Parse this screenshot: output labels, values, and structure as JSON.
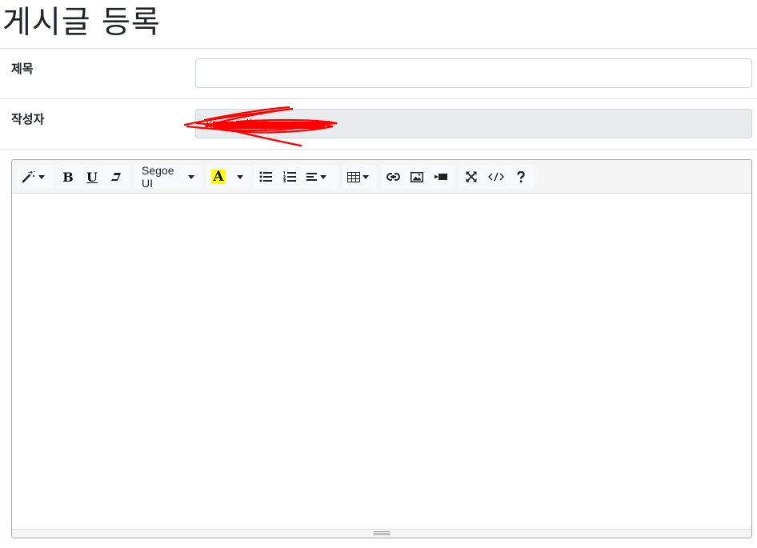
{
  "page": {
    "title": "게시글 등록"
  },
  "form": {
    "title_label": "제목",
    "title_value": "",
    "author_label": "작성자",
    "author_value": "kimcoding"
  },
  "editor": {
    "font_name": "Segoe UI",
    "highlight_color": "#ffff00",
    "content": ""
  }
}
